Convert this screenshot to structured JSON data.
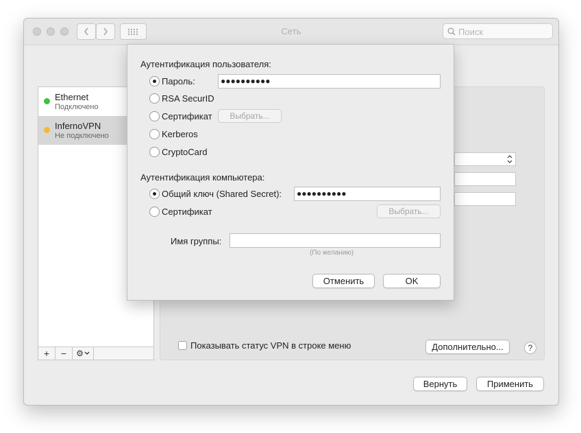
{
  "window": {
    "title": "Сеть",
    "search_placeholder": "Поиск"
  },
  "sidebar": {
    "services": [
      {
        "name": "Ethernet",
        "status": "Подключено",
        "status_color": "#3ec23e"
      },
      {
        "name": "InfernoVPN",
        "status": "Не подключено",
        "status_color": "#f5b73b"
      }
    ],
    "tools": {
      "add": "+",
      "remove": "−",
      "gear": "⚙"
    }
  },
  "main": {
    "show_vpn_status_label": "Показывать статус VPN в строке меню",
    "advanced_button": "Дополнительно...",
    "help_button": "?",
    "revert_button": "Вернуть",
    "apply_button": "Применить"
  },
  "sheet": {
    "user_auth_title": "Аутентификация пользователя:",
    "user_auth_options": [
      {
        "label": "Пароль:",
        "selected": true
      },
      {
        "label": "RSA SecurID",
        "selected": false
      },
      {
        "label": "Сертификат",
        "selected": false
      },
      {
        "label": "Kerberos",
        "selected": false
      },
      {
        "label": "CryptoCard",
        "selected": false
      }
    ],
    "password_value": "●●●●●●●●●●",
    "select_button": "Выбрать...",
    "machine_auth_title": "Аутентификация компьютера:",
    "machine_auth_options": [
      {
        "label": "Общий ключ (Shared Secret):",
        "selected": true
      },
      {
        "label": "Сертификат",
        "selected": false
      }
    ],
    "shared_secret_value": "●●●●●●●●●●",
    "machine_select_button": "Выбрать...",
    "group_name_label": "Имя группы:",
    "group_name_value": "",
    "group_name_hint": "(По желанию)",
    "cancel_button": "Отменить",
    "ok_button": "OK"
  }
}
